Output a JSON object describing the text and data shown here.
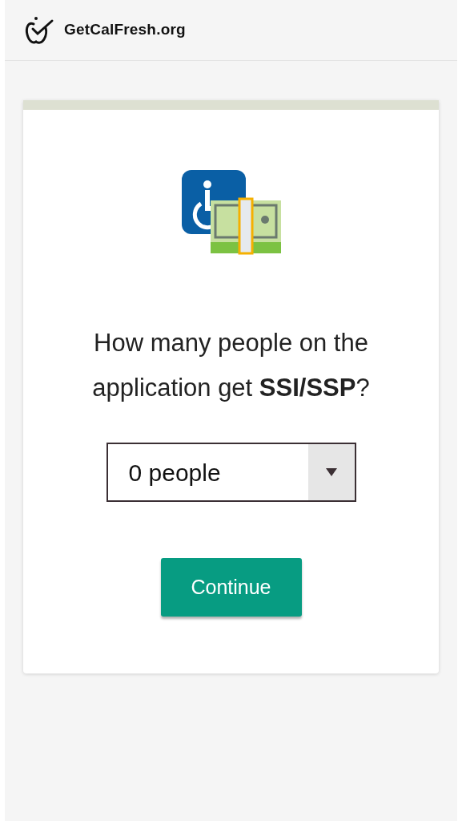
{
  "header": {
    "site_name": "GetCalFresh.org"
  },
  "card": {
    "question": "How many people on the application get **SSI/SSP**?",
    "select": {
      "value": "0 people"
    },
    "button": "Continue"
  }
}
